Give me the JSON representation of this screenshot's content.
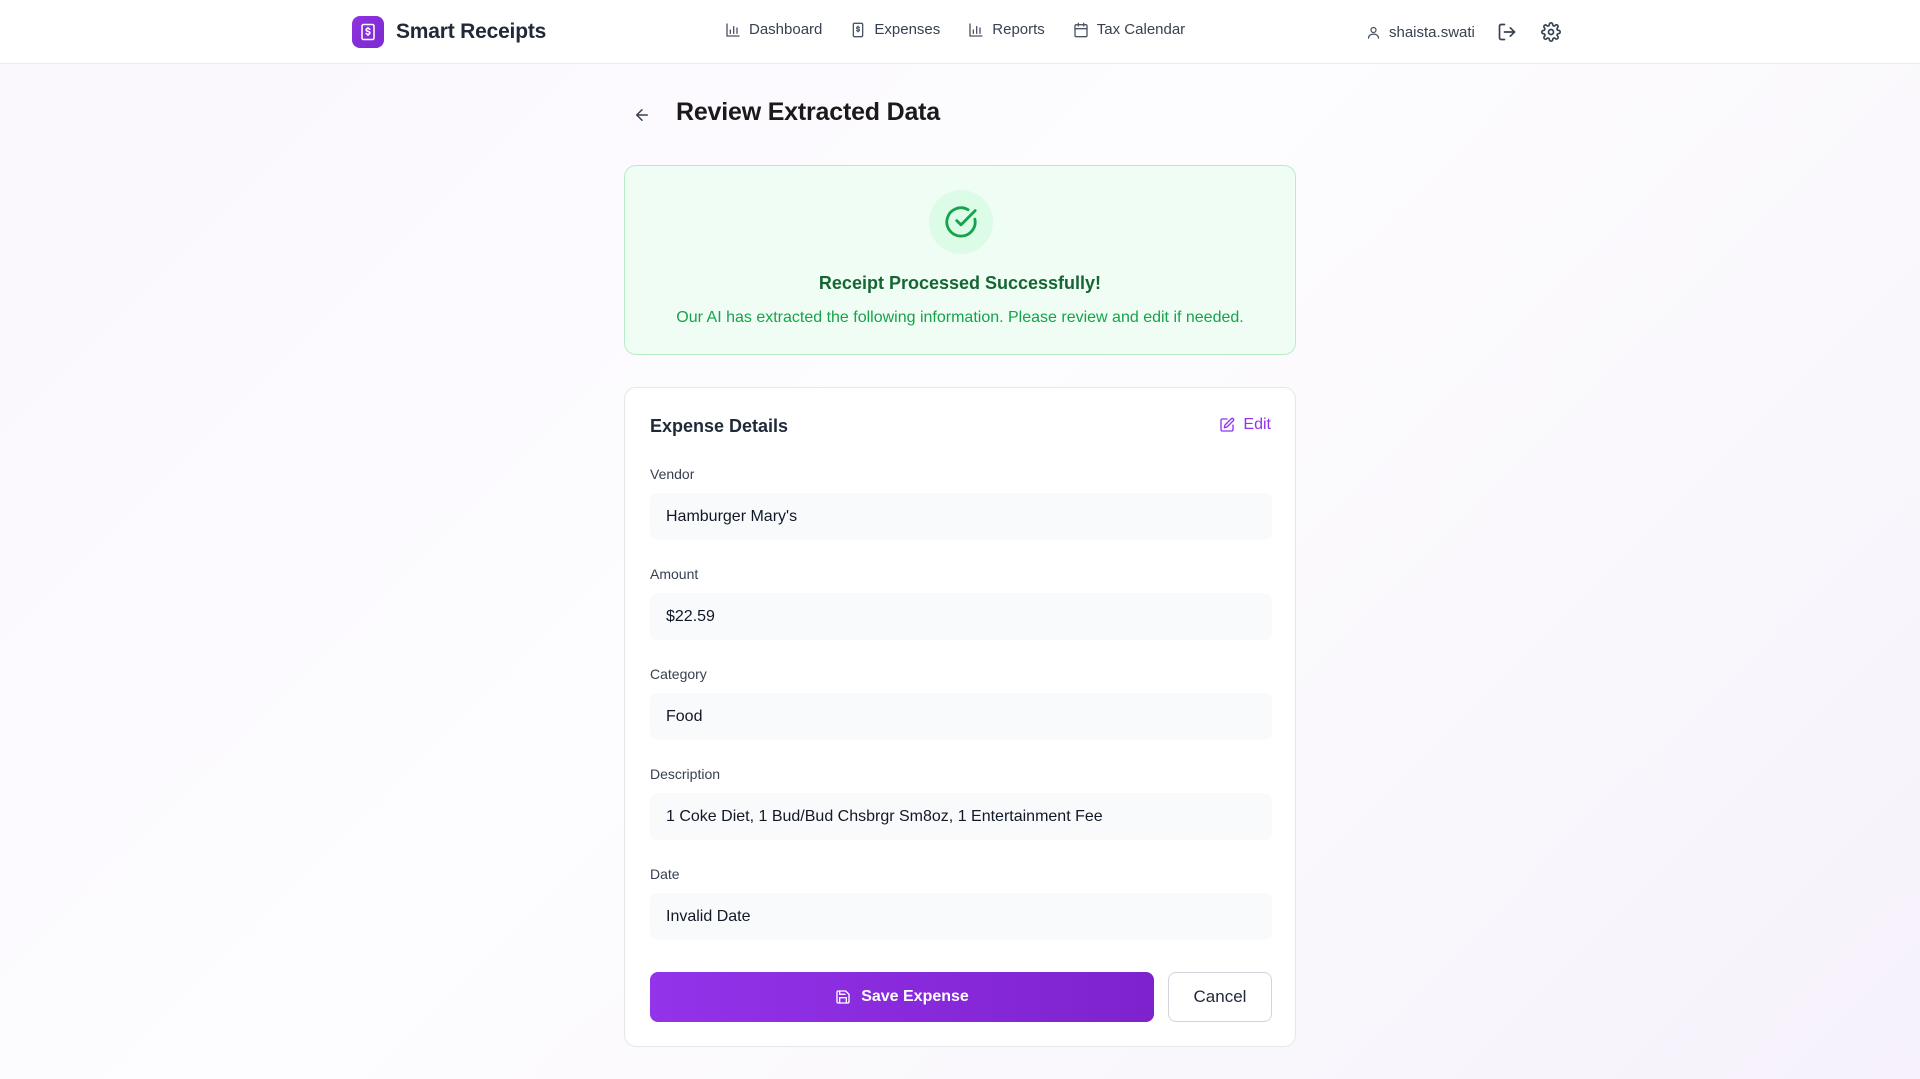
{
  "app": {
    "name": "Smart Receipts",
    "logo_icon": "receipt-dollar-icon",
    "accent_color": "#9333ea"
  },
  "nav": [
    {
      "label": "Dashboard",
      "icon": "bar-chart-icon"
    },
    {
      "label": "Expenses",
      "icon": "receipt-icon"
    },
    {
      "label": "Reports",
      "icon": "bar-chart-icon"
    },
    {
      "label": "Tax Calendar",
      "icon": "calendar-icon"
    }
  ],
  "user": {
    "username": "shaista.swati",
    "icon": "user-icon"
  },
  "header_actions": {
    "logout_icon": "logout-icon",
    "settings_icon": "gear-icon"
  },
  "page": {
    "title": "Review Extracted Data",
    "back_icon": "arrow-left-icon"
  },
  "success": {
    "title": "Receipt Processed Successfully!",
    "message": "Our AI has extracted the following information. Please review and edit if needed.",
    "icon": "check-circle-icon",
    "color": "#16a34a"
  },
  "details": {
    "title": "Expense Details",
    "edit_label": "Edit",
    "fields": {
      "vendor": {
        "label": "Vendor",
        "value": "Hamburger Mary's"
      },
      "amount": {
        "label": "Amount",
        "value": "$22.59"
      },
      "category": {
        "label": "Category",
        "value": "Food"
      },
      "description": {
        "label": "Description",
        "value": "1 Coke Diet, 1 Bud/Bud Chsbrgr Sm8oz, 1 Entertainment Fee"
      },
      "date": {
        "label": "Date",
        "value": "Invalid Date"
      }
    },
    "save_label": "Save Expense",
    "cancel_label": "Cancel"
  }
}
